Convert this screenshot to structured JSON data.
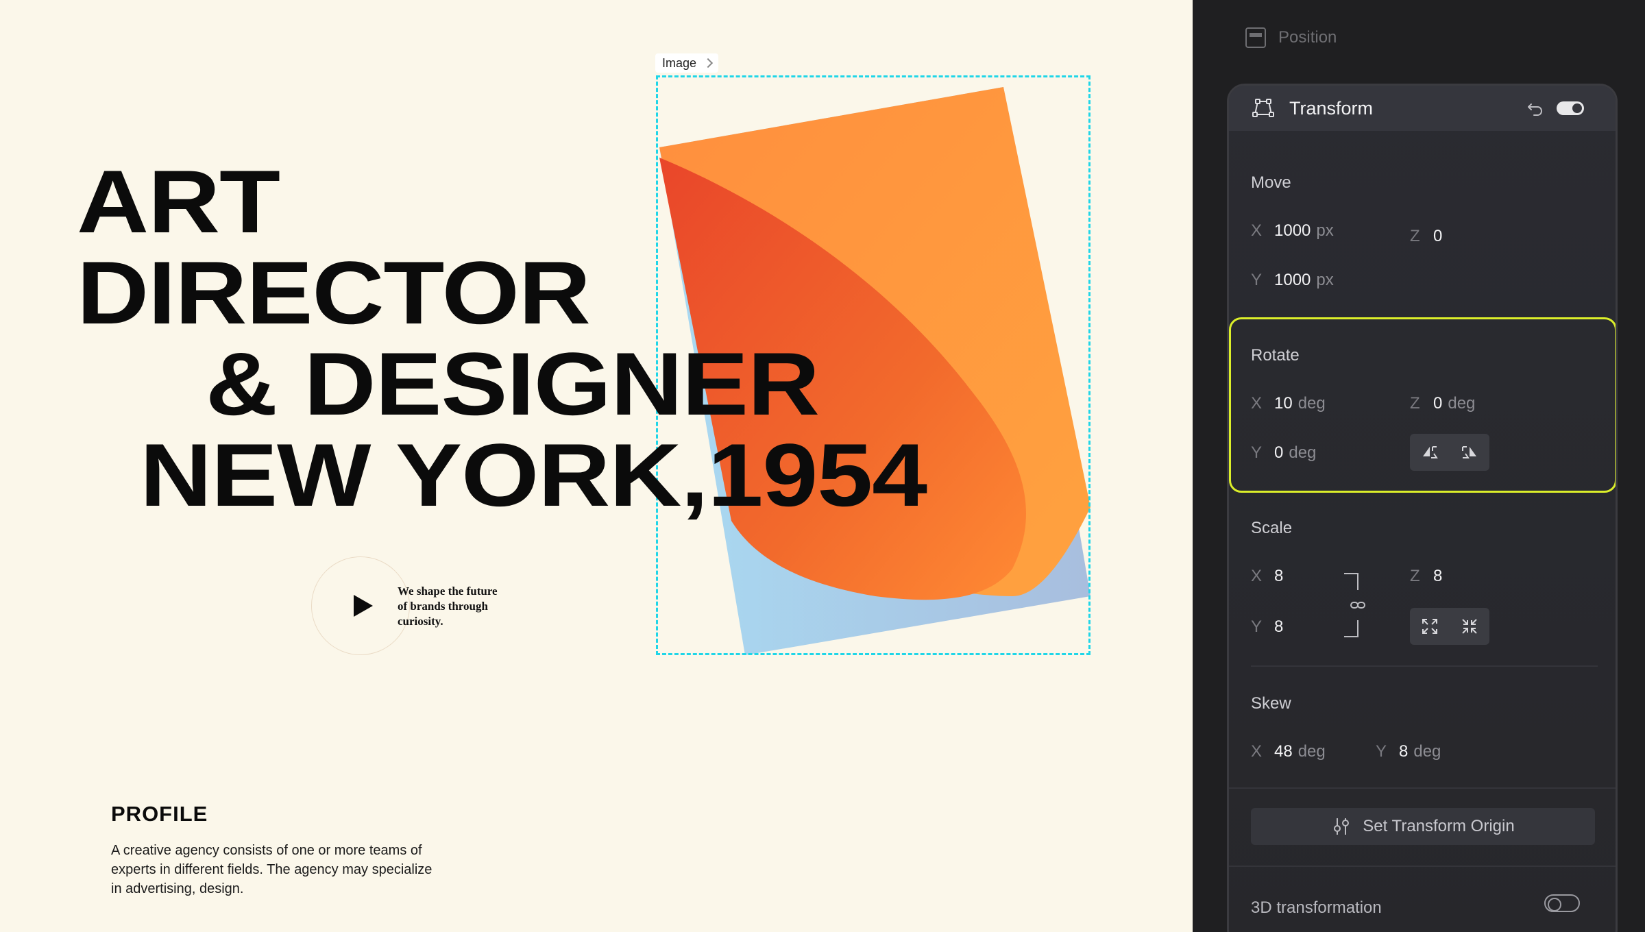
{
  "canvas": {
    "image_tag": "Image",
    "headline": [
      "ART",
      "DIRECTOR",
      "& DESIGNER",
      "NEW YORK,1954"
    ],
    "tagline": [
      "We shape the future",
      "of brands through",
      "curiosity."
    ],
    "profile_title": "PROFILE",
    "profile_body": [
      "A creative agency consists of one or more teams of",
      "experts in different fields. The agency may specialize",
      "in advertising, design."
    ],
    "selection_color": "#1fd6e8",
    "background": "#fbf7ea"
  },
  "panel": {
    "position_label": "Position",
    "transform": {
      "title": "Transform",
      "enabled": true,
      "move": {
        "title": "Move",
        "x_label": "X",
        "x_value": "1000",
        "x_unit": "px",
        "y_label": "Y",
        "y_value": "1000",
        "y_unit": "px",
        "z_label": "Z",
        "z_value": "0"
      },
      "rotate": {
        "title": "Rotate",
        "x_label": "X",
        "x_value": "10",
        "x_unit": "deg",
        "y_label": "Y",
        "y_value": "0",
        "y_unit": "deg",
        "z_label": "Z",
        "z_value": "0",
        "z_unit": "deg",
        "highlight_color": "#dcef2a"
      },
      "scale": {
        "title": "Scale",
        "x_label": "X",
        "x_value": "8",
        "y_label": "Y",
        "y_value": "8",
        "z_label": "Z",
        "z_value": "8"
      },
      "skew": {
        "title": "Skew",
        "x_label": "X",
        "x_value": "48",
        "x_unit": "deg",
        "y_label": "Y",
        "y_value": "8",
        "y_unit": "deg"
      },
      "origin_button": "Set Transform Origin",
      "d3_label": "3D transformation",
      "d3_enabled": false
    }
  }
}
